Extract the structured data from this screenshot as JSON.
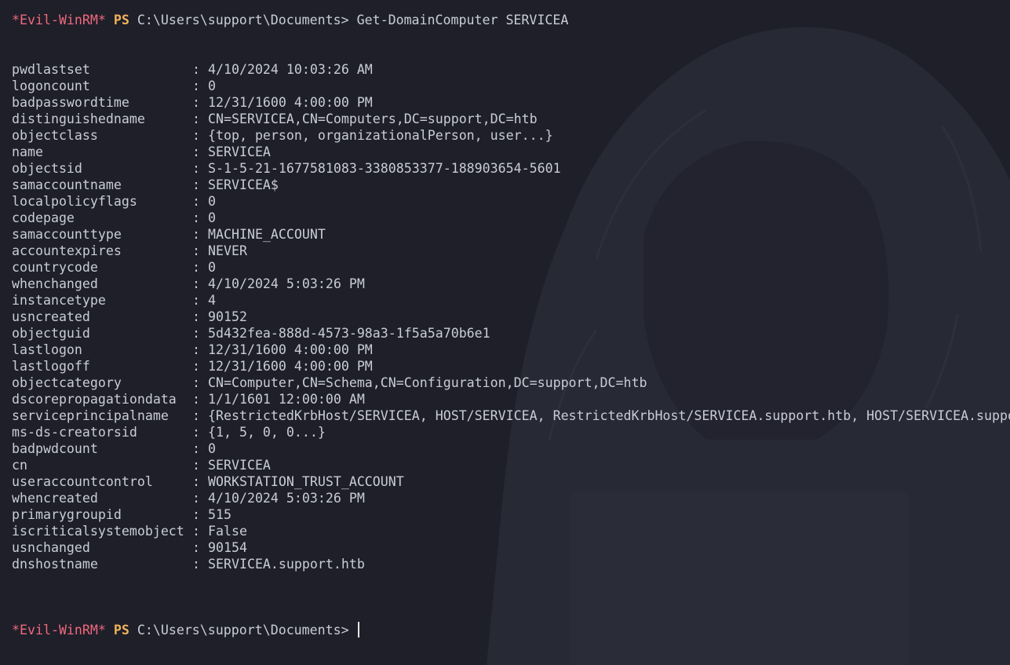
{
  "colors": {
    "background": "#1e1f29",
    "text": "#c9ccd6",
    "prompt_tag": "#f0687e",
    "prompt_ps": "#f1b25b"
  },
  "session1": {
    "prompt_tag": "*Evil-WinRM*",
    "prompt_ps": "PS",
    "prompt_path": "C:\\Users\\support\\Documents>",
    "command": "Get-DomainComputer SERVICEA"
  },
  "properties": [
    {
      "key": "pwdlastset",
      "value": "4/10/2024 10:03:26 AM"
    },
    {
      "key": "logoncount",
      "value": "0"
    },
    {
      "key": "badpasswordtime",
      "value": "12/31/1600 4:00:00 PM"
    },
    {
      "key": "distinguishedname",
      "value": "CN=SERVICEA,CN=Computers,DC=support,DC=htb"
    },
    {
      "key": "objectclass",
      "value": "{top, person, organizationalPerson, user...}"
    },
    {
      "key": "name",
      "value": "SERVICEA"
    },
    {
      "key": "objectsid",
      "value": "S-1-5-21-1677581083-3380853377-188903654-5601"
    },
    {
      "key": "samaccountname",
      "value": "SERVICEA$"
    },
    {
      "key": "localpolicyflags",
      "value": "0"
    },
    {
      "key": "codepage",
      "value": "0"
    },
    {
      "key": "samaccounttype",
      "value": "MACHINE_ACCOUNT"
    },
    {
      "key": "accountexpires",
      "value": "NEVER"
    },
    {
      "key": "countrycode",
      "value": "0"
    },
    {
      "key": "whenchanged",
      "value": "4/10/2024 5:03:26 PM"
    },
    {
      "key": "instancetype",
      "value": "4"
    },
    {
      "key": "usncreated",
      "value": "90152"
    },
    {
      "key": "objectguid",
      "value": "5d432fea-888d-4573-98a3-1f5a5a70b6e1"
    },
    {
      "key": "lastlogon",
      "value": "12/31/1600 4:00:00 PM"
    },
    {
      "key": "lastlogoff",
      "value": "12/31/1600 4:00:00 PM"
    },
    {
      "key": "objectcategory",
      "value": "CN=Computer,CN=Schema,CN=Configuration,DC=support,DC=htb"
    },
    {
      "key": "dscorepropagationdata",
      "value": "1/1/1601 12:00:00 AM"
    },
    {
      "key": "serviceprincipalname",
      "value": "{RestrictedKrbHost/SERVICEA, HOST/SERVICEA, RestrictedKrbHost/SERVICEA.support.htb, HOST/SERVICEA.suppo"
    },
    {
      "key": "ms-ds-creatorsid",
      "value": "{1, 5, 0, 0...}"
    },
    {
      "key": "badpwdcount",
      "value": "0"
    },
    {
      "key": "cn",
      "value": "SERVICEA"
    },
    {
      "key": "useraccountcontrol",
      "value": "WORKSTATION_TRUST_ACCOUNT"
    },
    {
      "key": "whencreated",
      "value": "4/10/2024 5:03:26 PM"
    },
    {
      "key": "primarygroupid",
      "value": "515"
    },
    {
      "key": "iscriticalsystemobject",
      "value": "False"
    },
    {
      "key": "usnchanged",
      "value": "90154"
    },
    {
      "key": "dnshostname",
      "value": "SERVICEA.support.htb"
    }
  ],
  "property_separator": ":",
  "session2": {
    "prompt_tag": "*Evil-WinRM*",
    "prompt_ps": "PS",
    "prompt_path": "C:\\Users\\support\\Documents>",
    "command": ""
  }
}
